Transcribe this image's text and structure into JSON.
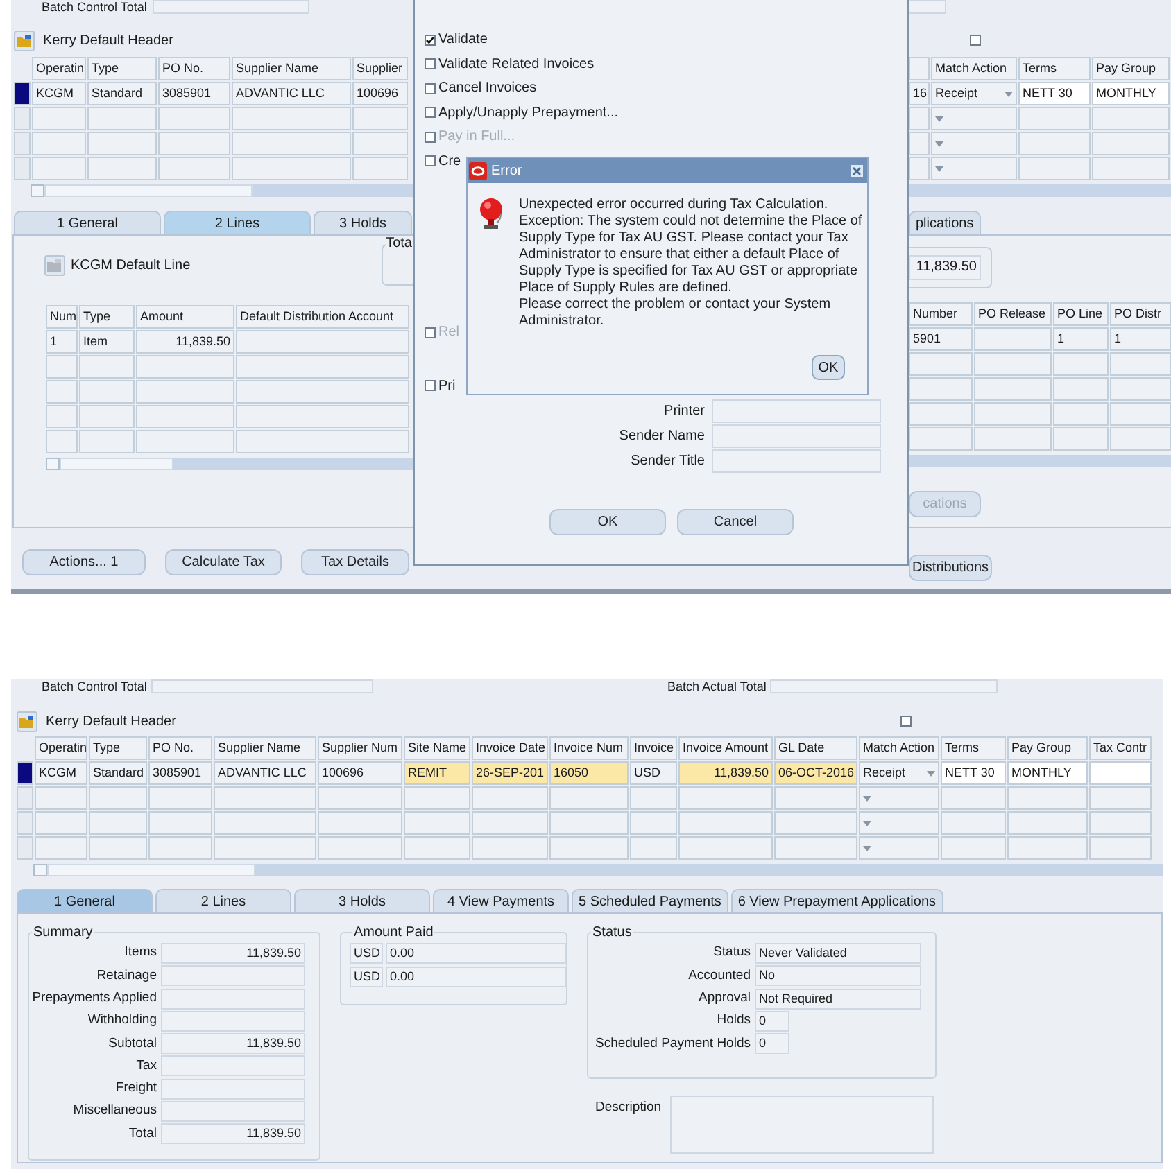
{
  "top_screen": {
    "batch_control_label": "Batch Control Total",
    "header_title": "Kerry Default Header",
    "header_checkbox": {
      "checked": false
    },
    "header_table_left": {
      "columns": [
        {
          "label": "Operatin"
        },
        {
          "label": "Type"
        },
        {
          "label": "PO No."
        },
        {
          "label": "Supplier Name"
        },
        {
          "label": "Supplier"
        }
      ],
      "rows": [
        {
          "selected": true,
          "cells": [
            "KCGM",
            "Standard",
            "3085901",
            "ADVANTIC LLC",
            "100696"
          ]
        }
      ]
    },
    "header_table_right": {
      "columns": [
        {
          "kind": "readonly"
        },
        {
          "label": "Match Action",
          "kind": "dropdown"
        },
        {
          "label": "Terms",
          "kind": "editable"
        },
        {
          "label": "Pay Group",
          "kind": "editable"
        }
      ],
      "rows": [
        {
          "cells": [
            "16",
            "Receipt",
            "NETT 30",
            "MONTHLY"
          ]
        }
      ]
    },
    "tabs": [
      {
        "label": "1 General",
        "selected": false
      },
      {
        "label": "2 Lines",
        "selected": true
      },
      {
        "label": "3 Holds",
        "selected": false
      }
    ],
    "tab_cut": {
      "label": "plications",
      "selected": false
    },
    "lines": {
      "header_title": "KCGM Default Line",
      "total_label": "Total",
      "total_value": "11,839.50",
      "table_left": {
        "columns": [
          {
            "label": "Num"
          },
          {
            "label": "Type"
          },
          {
            "label": "Amount",
            "kind": "number"
          },
          {
            "label": "Default Distribution Account"
          }
        ],
        "rows": [
          {
            "cells": [
              "1",
              "Item",
              "11,839.50",
              null
            ]
          }
        ]
      },
      "table_right": {
        "columns": [
          {
            "label": "Number"
          },
          {
            "label": "PO Release"
          },
          {
            "label": "PO Line"
          },
          {
            "label": "PO Distr"
          }
        ],
        "rows": [
          {
            "cells": [
              "5901",
              null,
              "1",
              "1"
            ]
          }
        ]
      },
      "panel_button": {
        "label": "cations",
        "disabled": true
      }
    },
    "buttons_left": [
      "Actions... 1",
      "Calculate Tax",
      "Tax Details"
    ],
    "button_right": {
      "label": "Distributions",
      "disabled": false
    },
    "actions_dialog": {
      "options": [
        {
          "label": "Validate",
          "checked": true,
          "disabled": false
        },
        {
          "label": "Validate Related Invoices",
          "checked": false,
          "disabled": false
        },
        {
          "label": "Cancel Invoices",
          "checked": false,
          "disabled": false
        },
        {
          "label": "Apply/Unapply Prepayment...",
          "checked": false,
          "disabled": false
        },
        {
          "label": "Pay in Full...",
          "checked": false,
          "disabled": true
        },
        {
          "label": "Cre",
          "checked": false,
          "disabled": false
        },
        {
          "label": "Rel",
          "checked": false,
          "disabled": true
        },
        {
          "label": "Pri",
          "checked": false,
          "disabled": false
        }
      ],
      "fields": [
        {
          "label": "Printer"
        },
        {
          "label": "Sender Name"
        },
        {
          "label": "Sender Title"
        }
      ],
      "buttons": [
        "OK",
        "Cancel"
      ]
    },
    "error_dialog": {
      "title": "Error",
      "paragraphs": [
        "Unexpected error occurred during Tax Calculation.",
        "Exception: The system could not determine the Place of Supply Type for Tax AU GST. Please contact your Tax Administrator to ensure that either a default Place of Supply Type is specified for Tax AU GST or appropriate Place of Supply Rules are defined.",
        "Please correct the problem or contact your System Administrator."
      ],
      "button": "OK"
    }
  },
  "bottom_screen": {
    "batch_control_label": "Batch Control Total",
    "batch_actual_label": "Batch Actual Total",
    "header_title": "Kerry Default Header",
    "header_checkbox": {
      "checked": false
    },
    "header_table": {
      "columns": [
        {
          "label": "Operatin",
          "kind": "readonly"
        },
        {
          "label": "Type",
          "kind": "readonly"
        },
        {
          "label": "PO No.",
          "kind": "readonly"
        },
        {
          "label": "Supplier Name",
          "kind": "readonly"
        },
        {
          "label": "Supplier Num",
          "kind": "readonly"
        },
        {
          "label": "Site Name",
          "kind": "required"
        },
        {
          "label": "Invoice Date",
          "kind": "required"
        },
        {
          "label": "Invoice Num",
          "kind": "required"
        },
        {
          "label": "Invoice",
          "kind": "readonly"
        },
        {
          "label": "Invoice Amount",
          "kind": "required_number"
        },
        {
          "label": "GL Date",
          "kind": "required"
        },
        {
          "label": "Match Action",
          "kind": "dropdown"
        },
        {
          "label": "Terms",
          "kind": "editable"
        },
        {
          "label": "Pay Group",
          "kind": "editable"
        },
        {
          "label": "Tax Contr",
          "kind": "editable"
        }
      ],
      "rows": [
        {
          "selected": true,
          "cells": [
            "KCGM",
            "Standard",
            "3085901",
            "ADVANTIC LLC",
            "100696",
            "REMIT",
            "26-SEP-201",
            "16050",
            "USD",
            "11,839.50",
            "06-OCT-2016",
            "Receipt",
            "NETT 30",
            "MONTHLY",
            null
          ]
        }
      ]
    },
    "tabs": [
      {
        "label": "1 General",
        "selected": true
      },
      {
        "label": "2 Lines",
        "selected": false
      },
      {
        "label": "3 Holds",
        "selected": false
      },
      {
        "label": "4 View Payments",
        "selected": false
      },
      {
        "label": "5 Scheduled Payments",
        "selected": false
      },
      {
        "label": "6 View Prepayment Applications",
        "selected": false
      }
    ],
    "summary": {
      "title": "Summary",
      "rows": [
        {
          "label": "Items",
          "value": "11,839.50"
        },
        {
          "label": "Retainage"
        },
        {
          "label": "Prepayments Applied"
        },
        {
          "label": "Withholding"
        },
        {
          "label": "Subtotal",
          "value": "11,839.50"
        },
        {
          "label": "Tax"
        },
        {
          "label": "Freight"
        },
        {
          "label": "Miscellaneous"
        },
        {
          "label": "Total",
          "value": "11,839.50"
        }
      ]
    },
    "amount_paid": {
      "title": "Amount Paid",
      "rows": [
        {
          "currency": "USD",
          "value": "0.00"
        },
        {
          "currency": "USD",
          "value": "0.00"
        }
      ]
    },
    "status": {
      "title": "Status",
      "rows": [
        {
          "label": "Status",
          "value": "Never Validated"
        },
        {
          "label": "Accounted",
          "value": "No"
        },
        {
          "label": "Approval",
          "value": "Not Required"
        },
        {
          "label": "Holds",
          "value": "0"
        },
        {
          "label": "Scheduled Payment Holds",
          "value": "0"
        }
      ]
    },
    "description_label": "Description"
  }
}
